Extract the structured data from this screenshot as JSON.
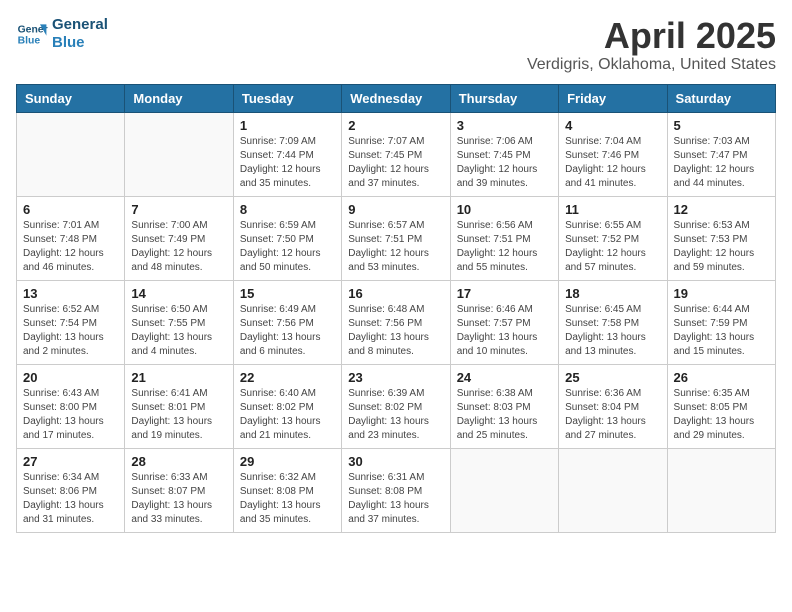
{
  "header": {
    "logo_line1": "General",
    "logo_line2": "Blue",
    "month_year": "April 2025",
    "location": "Verdigris, Oklahoma, United States"
  },
  "weekdays": [
    "Sunday",
    "Monday",
    "Tuesday",
    "Wednesday",
    "Thursday",
    "Friday",
    "Saturday"
  ],
  "weeks": [
    [
      {
        "day": "",
        "detail": ""
      },
      {
        "day": "",
        "detail": ""
      },
      {
        "day": "1",
        "detail": "Sunrise: 7:09 AM\nSunset: 7:44 PM\nDaylight: 12 hours\nand 35 minutes."
      },
      {
        "day": "2",
        "detail": "Sunrise: 7:07 AM\nSunset: 7:45 PM\nDaylight: 12 hours\nand 37 minutes."
      },
      {
        "day": "3",
        "detail": "Sunrise: 7:06 AM\nSunset: 7:45 PM\nDaylight: 12 hours\nand 39 minutes."
      },
      {
        "day": "4",
        "detail": "Sunrise: 7:04 AM\nSunset: 7:46 PM\nDaylight: 12 hours\nand 41 minutes."
      },
      {
        "day": "5",
        "detail": "Sunrise: 7:03 AM\nSunset: 7:47 PM\nDaylight: 12 hours\nand 44 minutes."
      }
    ],
    [
      {
        "day": "6",
        "detail": "Sunrise: 7:01 AM\nSunset: 7:48 PM\nDaylight: 12 hours\nand 46 minutes."
      },
      {
        "day": "7",
        "detail": "Sunrise: 7:00 AM\nSunset: 7:49 PM\nDaylight: 12 hours\nand 48 minutes."
      },
      {
        "day": "8",
        "detail": "Sunrise: 6:59 AM\nSunset: 7:50 PM\nDaylight: 12 hours\nand 50 minutes."
      },
      {
        "day": "9",
        "detail": "Sunrise: 6:57 AM\nSunset: 7:51 PM\nDaylight: 12 hours\nand 53 minutes."
      },
      {
        "day": "10",
        "detail": "Sunrise: 6:56 AM\nSunset: 7:51 PM\nDaylight: 12 hours\nand 55 minutes."
      },
      {
        "day": "11",
        "detail": "Sunrise: 6:55 AM\nSunset: 7:52 PM\nDaylight: 12 hours\nand 57 minutes."
      },
      {
        "day": "12",
        "detail": "Sunrise: 6:53 AM\nSunset: 7:53 PM\nDaylight: 12 hours\nand 59 minutes."
      }
    ],
    [
      {
        "day": "13",
        "detail": "Sunrise: 6:52 AM\nSunset: 7:54 PM\nDaylight: 13 hours\nand 2 minutes."
      },
      {
        "day": "14",
        "detail": "Sunrise: 6:50 AM\nSunset: 7:55 PM\nDaylight: 13 hours\nand 4 minutes."
      },
      {
        "day": "15",
        "detail": "Sunrise: 6:49 AM\nSunset: 7:56 PM\nDaylight: 13 hours\nand 6 minutes."
      },
      {
        "day": "16",
        "detail": "Sunrise: 6:48 AM\nSunset: 7:56 PM\nDaylight: 13 hours\nand 8 minutes."
      },
      {
        "day": "17",
        "detail": "Sunrise: 6:46 AM\nSunset: 7:57 PM\nDaylight: 13 hours\nand 10 minutes."
      },
      {
        "day": "18",
        "detail": "Sunrise: 6:45 AM\nSunset: 7:58 PM\nDaylight: 13 hours\nand 13 minutes."
      },
      {
        "day": "19",
        "detail": "Sunrise: 6:44 AM\nSunset: 7:59 PM\nDaylight: 13 hours\nand 15 minutes."
      }
    ],
    [
      {
        "day": "20",
        "detail": "Sunrise: 6:43 AM\nSunset: 8:00 PM\nDaylight: 13 hours\nand 17 minutes."
      },
      {
        "day": "21",
        "detail": "Sunrise: 6:41 AM\nSunset: 8:01 PM\nDaylight: 13 hours\nand 19 minutes."
      },
      {
        "day": "22",
        "detail": "Sunrise: 6:40 AM\nSunset: 8:02 PM\nDaylight: 13 hours\nand 21 minutes."
      },
      {
        "day": "23",
        "detail": "Sunrise: 6:39 AM\nSunset: 8:02 PM\nDaylight: 13 hours\nand 23 minutes."
      },
      {
        "day": "24",
        "detail": "Sunrise: 6:38 AM\nSunset: 8:03 PM\nDaylight: 13 hours\nand 25 minutes."
      },
      {
        "day": "25",
        "detail": "Sunrise: 6:36 AM\nSunset: 8:04 PM\nDaylight: 13 hours\nand 27 minutes."
      },
      {
        "day": "26",
        "detail": "Sunrise: 6:35 AM\nSunset: 8:05 PM\nDaylight: 13 hours\nand 29 minutes."
      }
    ],
    [
      {
        "day": "27",
        "detail": "Sunrise: 6:34 AM\nSunset: 8:06 PM\nDaylight: 13 hours\nand 31 minutes."
      },
      {
        "day": "28",
        "detail": "Sunrise: 6:33 AM\nSunset: 8:07 PM\nDaylight: 13 hours\nand 33 minutes."
      },
      {
        "day": "29",
        "detail": "Sunrise: 6:32 AM\nSunset: 8:08 PM\nDaylight: 13 hours\nand 35 minutes."
      },
      {
        "day": "30",
        "detail": "Sunrise: 6:31 AM\nSunset: 8:08 PM\nDaylight: 13 hours\nand 37 minutes."
      },
      {
        "day": "",
        "detail": ""
      },
      {
        "day": "",
        "detail": ""
      },
      {
        "day": "",
        "detail": ""
      }
    ]
  ]
}
